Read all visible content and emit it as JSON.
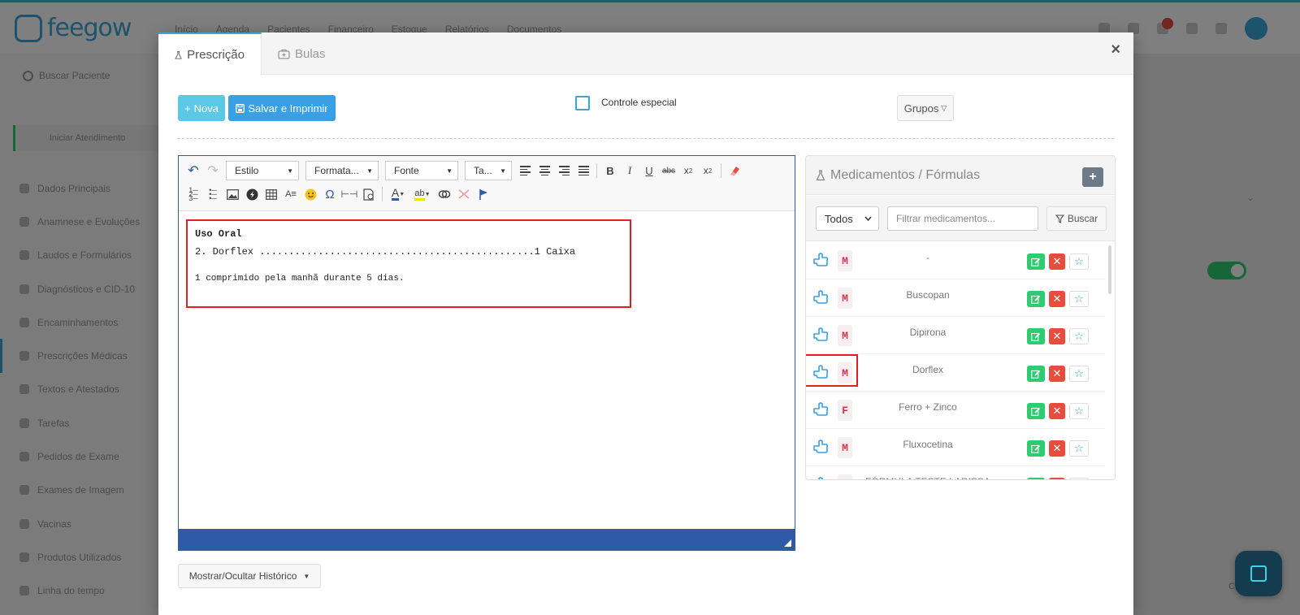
{
  "app": {
    "logo_text": "feegow",
    "topnav": [
      "Início",
      "Agenda",
      "Pacientes",
      "Financeiro",
      "Estoque",
      "Relatórios",
      "Documentos"
    ],
    "search_placeholder": "Buscar Paciente",
    "new_attendance": "Iniciar Atendimento",
    "sidebar_items": [
      "Dados Principais",
      "Anamnese e Evoluções",
      "Laudos e Formulários",
      "Diagnósticos e CID-10",
      "Encaminhamentos",
      "Prescrições Médicas",
      "Textos e Atestados",
      "Tarefas",
      "Pedidos de Exame",
      "Exames de Imagem",
      "Vacinas",
      "Produtos Utilizados",
      "Linha do tempo"
    ],
    "active_sidebar_index": 5,
    "cancel_label": "Cancelar"
  },
  "modal": {
    "tabs": [
      {
        "label": "Prescrição",
        "icon": "flask-icon",
        "active": true
      },
      {
        "label": "Bulas",
        "icon": "medkit-icon",
        "active": false
      }
    ],
    "close_label": "×",
    "nova_label": "Nova",
    "salvar_label": "Salvar e Imprimir",
    "controle_especial_label": "Controle especial",
    "controle_especial_checked": false,
    "grupos_label": "Grupos",
    "historico_label": "Mostrar/Ocultar Histórico"
  },
  "editor": {
    "style_select": "Estilo",
    "format_select": "Formata...",
    "font_select": "Fonte",
    "size_select": "Ta...",
    "content_lines": [
      "Uso Oral",
      "2. Dorflex ...............................................1 Caixa",
      "1 comprimido pela manhã durante 5 dias."
    ]
  },
  "medicamentos": {
    "title": "Medicamentos / Fórmulas",
    "add_label": "+",
    "filter_select": "Todos",
    "filter_placeholder": "Filtrar medicamentos...",
    "search_label": "Buscar",
    "items": [
      {
        "type": "M",
        "name": "-"
      },
      {
        "type": "M",
        "name": "Buscopan"
      },
      {
        "type": "M",
        "name": "Dipirona"
      },
      {
        "type": "M",
        "name": "Dorflex"
      },
      {
        "type": "F",
        "name": "Ferro + Zinco"
      },
      {
        "type": "M",
        "name": "Fluxocetina"
      },
      {
        "type": "F",
        "name": "FÓRMULA TESTE LARISSA"
      }
    ],
    "highlighted_index": 3
  },
  "colors": {
    "accent": "#3aa7d9",
    "nova_btn": "#5bc8e8",
    "salvar_btn": "#3aa0e6",
    "editor_border": "#2e5aa7",
    "highlight": "#e02020",
    "edit_green": "#2ecc71",
    "delete_red": "#e74c3c"
  }
}
